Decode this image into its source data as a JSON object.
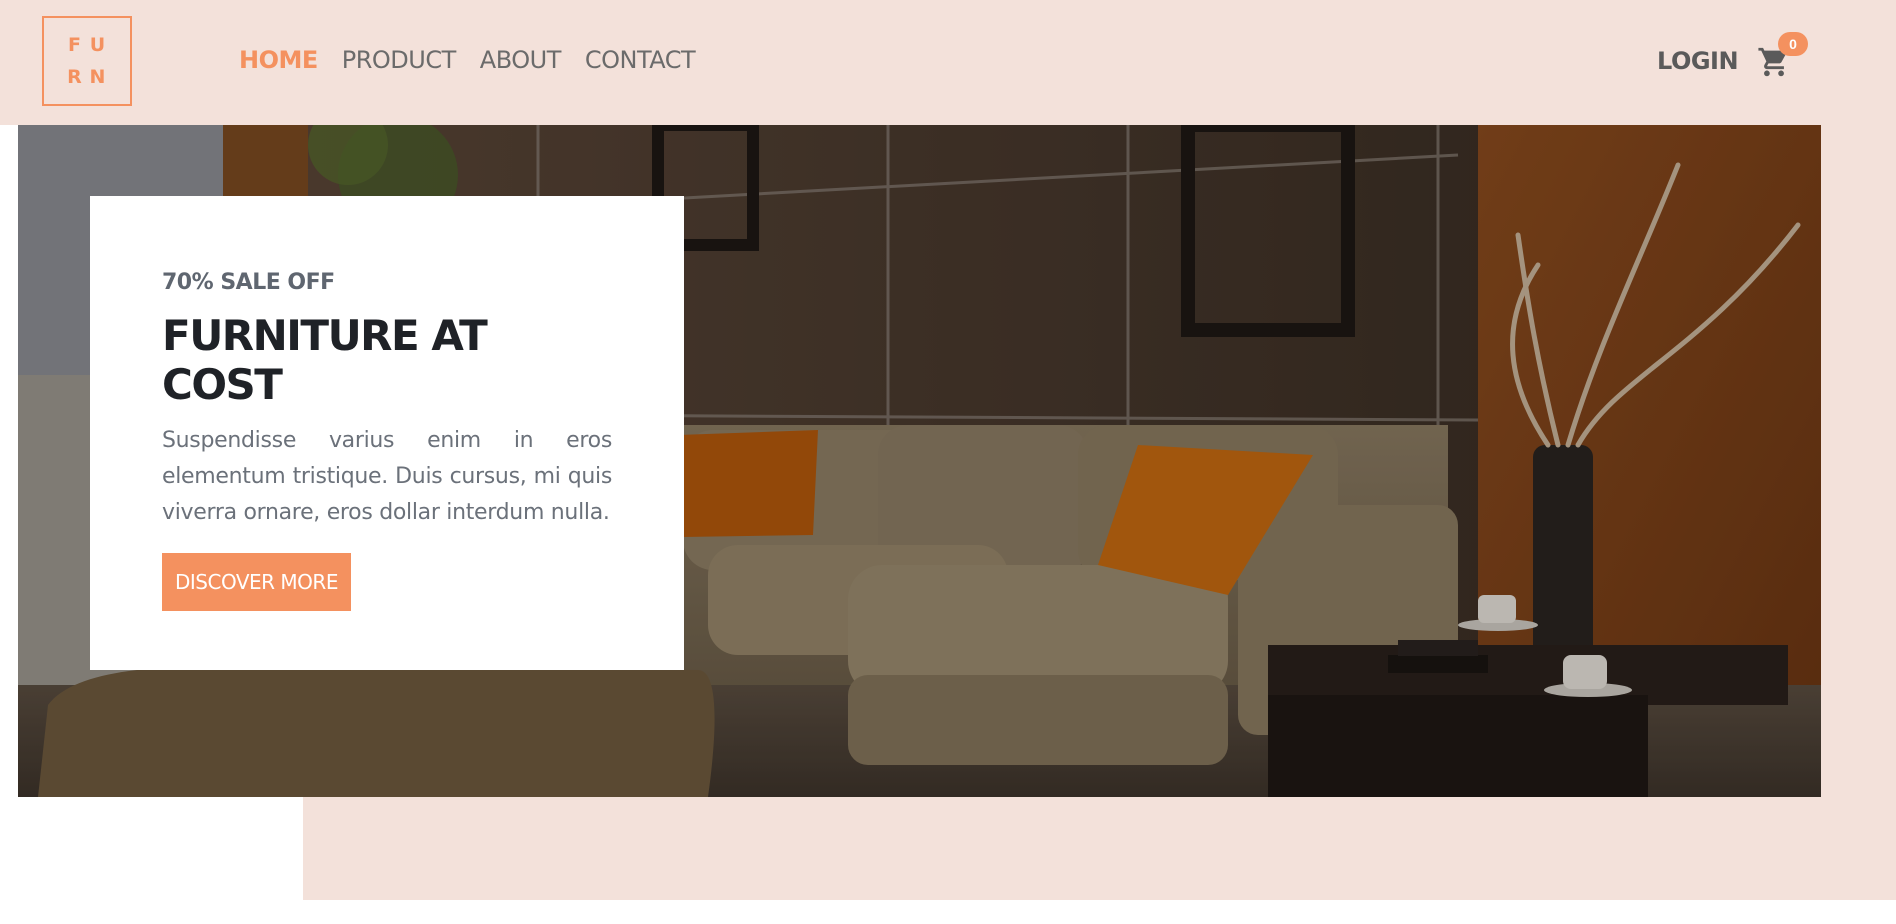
{
  "logo": {
    "letters": [
      "F",
      "U",
      "R",
      "N"
    ]
  },
  "nav": {
    "items": [
      {
        "label": "HOME",
        "active": true
      },
      {
        "label": "PRODUCT",
        "active": false
      },
      {
        "label": "ABOUT",
        "active": false
      },
      {
        "label": "CONTACT",
        "active": false
      }
    ],
    "login_label": "LOGIN",
    "cart_count": "0",
    "cart_icon": "shopping-cart-icon"
  },
  "hero": {
    "eyebrow": "70% SALE OFF",
    "title": "FURNITURE AT COST",
    "description": "Suspendisse varius enim in eros elementum tristique. Duis cursus, mi quis viverra ornare, eros dollar interdum nulla.",
    "button_label": "DISCOVER MORE"
  },
  "colors": {
    "accent": "#f4915f",
    "background_tint": "#f3e1da",
    "heading": "#1f2227",
    "body_text": "#6b717a"
  }
}
